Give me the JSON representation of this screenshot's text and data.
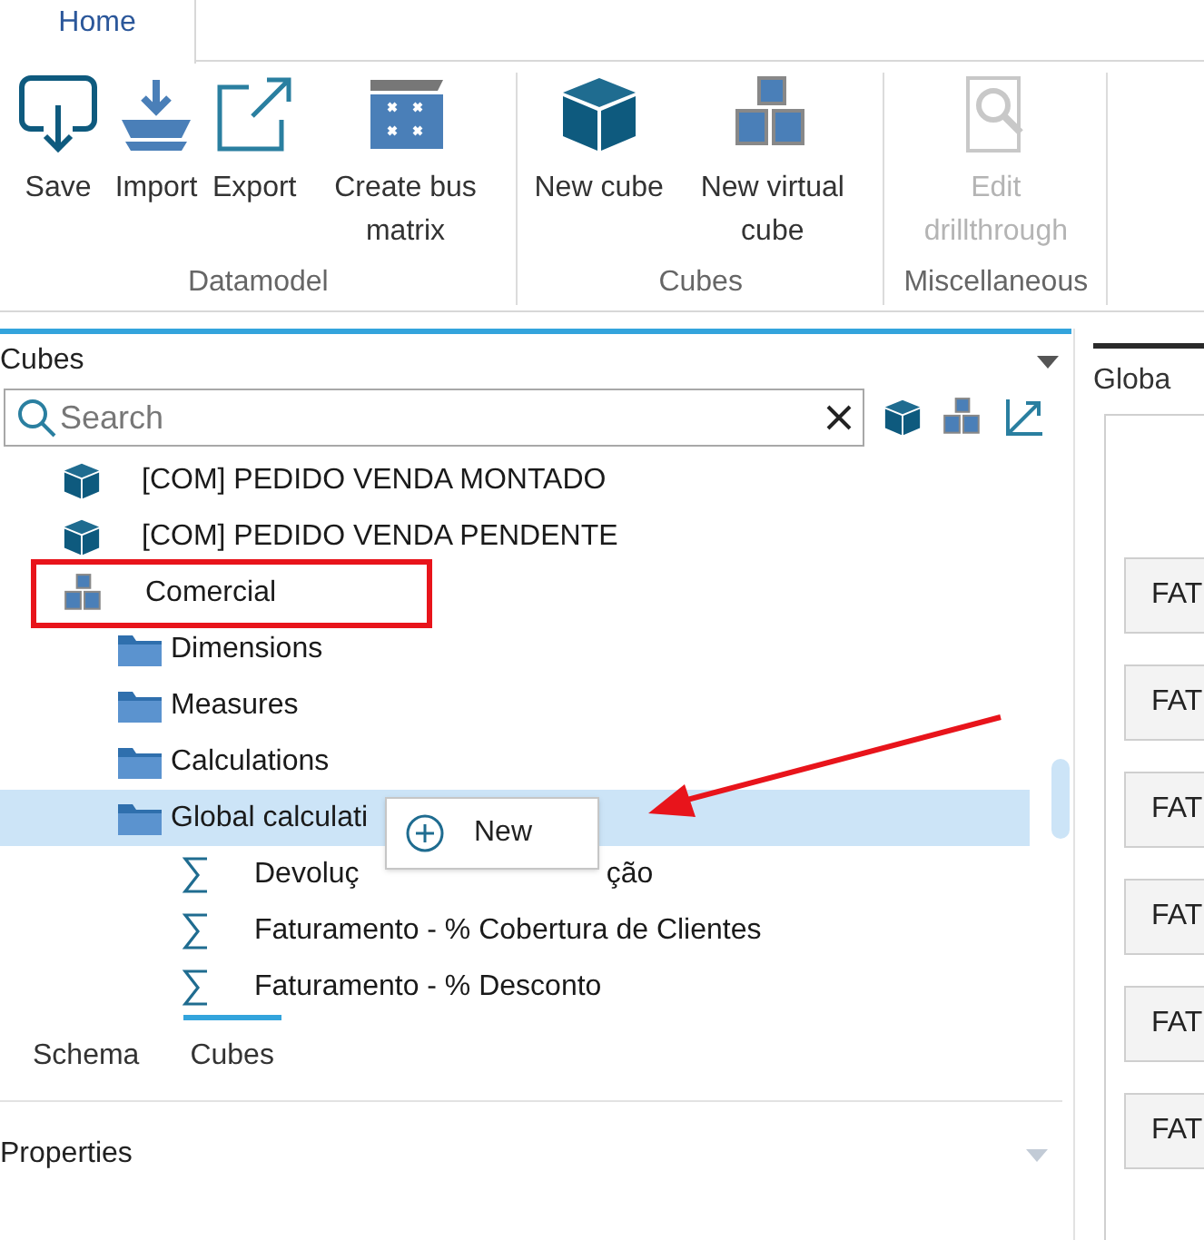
{
  "ribbon": {
    "tabs": [
      {
        "label": "Home",
        "selected": true
      }
    ],
    "groups": [
      {
        "label": "Datamodel",
        "buttons": [
          {
            "kind": "save",
            "label": "Save",
            "disabled": false
          },
          {
            "kind": "import",
            "label": "Import",
            "disabled": false
          },
          {
            "kind": "export",
            "label": "Export",
            "disabled": false
          },
          {
            "kind": "matrix",
            "label": "Create bus matrix",
            "disabled": false
          }
        ]
      },
      {
        "label": "Cubes",
        "buttons": [
          {
            "kind": "cube",
            "label": "New cube",
            "disabled": false
          },
          {
            "kind": "virtual",
            "label": "New virtual cube",
            "disabled": false
          }
        ]
      },
      {
        "label": "Miscellaneous",
        "buttons": [
          {
            "kind": "drill",
            "label": "Edit drillthrough",
            "disabled": true
          }
        ]
      }
    ]
  },
  "cubes_panel": {
    "title": "Cubes",
    "search": {
      "placeholder": "Search"
    },
    "tree": [
      {
        "kind": "cube",
        "label": "[COM] PEDIDO VENDA MONTADO",
        "selected": false,
        "highlighted": false
      },
      {
        "kind": "cube",
        "label": "[COM] PEDIDO VENDA PENDENTE",
        "selected": false,
        "highlighted": false
      },
      {
        "kind": "virtual",
        "label": "Comercial",
        "selected": false,
        "highlighted": true,
        "children": [
          {
            "kind": "folder",
            "label": "Dimensions",
            "selected": false,
            "highlighted": false
          },
          {
            "kind": "folder",
            "label": "Measures",
            "selected": false,
            "highlighted": false
          },
          {
            "kind": "folder",
            "label": "Calculations",
            "selected": false,
            "highlighted": false
          },
          {
            "kind": "folder",
            "label": "Global calculati",
            "selected": true,
            "highlighted": false,
            "children": [
              {
                "kind": "calc",
                "label": "Devoluç",
                "label_after_menu": "ção",
                "selected": false,
                "highlighted": false
              },
              {
                "kind": "calc",
                "label": "Faturamento - % Cobertura de Clientes",
                "selected": false,
                "highlighted": false
              },
              {
                "kind": "calc",
                "label": "Faturamento - % Desconto",
                "selected": false,
                "highlighted": false
              }
            ]
          }
        ]
      }
    ],
    "context_menu": {
      "items": [
        {
          "label": "New"
        }
      ]
    },
    "tabs": [
      {
        "label": "Schema",
        "selected": false
      },
      {
        "label": "Cubes",
        "selected": true
      }
    ]
  },
  "properties_panel": {
    "title": "Properties"
  },
  "right_panel": {
    "tab": "Globa",
    "buttons": [
      "FAT",
      "FAT",
      "FAT",
      "FAT",
      "FAT",
      "FAT"
    ]
  }
}
